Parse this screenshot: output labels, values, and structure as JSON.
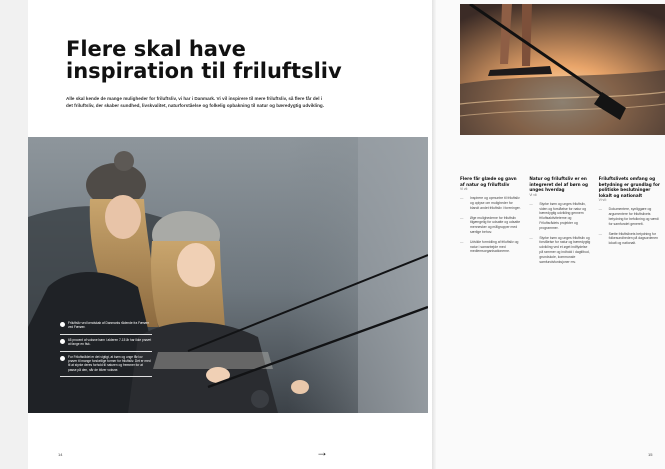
{
  "title_line1": "Flere skal have",
  "title_line2": "inspiration til friluftsliv",
  "intro": "Alle skal kende de mange muligheder for friluftsliv, vi har i Danmark. Vi vil inspirere til mere friluftsliv, så flere får del i det friluftsliv, der skaber sundhed, livskvalitet, naturforståelse og folkelig opbakning til natur og bæredygtig udvikling.",
  "facts": [
    "Friluftsliv ved kendskab af Danmarks rådende fra Færøer ved Færøer.",
    "65 procent af voksne børn i alderen 7-15 år har ikke prøvet at fange en fisk.",
    "For Friluftsrådet er det vigtigt, at børn og unge får lov prøver til mange forskellige former for friluftsliv. Det er med til at styrke deres forhold til naturen og fremmer for at passe på den, når de bliver voksne."
  ],
  "columns": [
    {
      "title": "Flere får glæde og gavn af natur og friluftsliv",
      "sub": "Vi vil:",
      "items": [
        "Inspirere og opmuntre til friluftsliv og oplyse om muligheder for blandt andet friluftsliv i foreninger.",
        "Øge mulighederne for friluftsliv tilgængelig for udsatte og udsatte mennesker og målgrupper med særlige behov.",
        "Udvikle formidling af friluftsliv og natur i samarbejde med medlemsorganisationerne."
      ]
    },
    {
      "title": "Natur og friluftsliv er en integreret del af børn og unges hverdag",
      "sub": "Vi vil:",
      "items": [
        "Styrke børn og unges friluftsliv, viden og forståelse for natur og bæredygtig udvikling gennem friluftsaktiviteterne og Friluftsrådets projekter og programmer.",
        "Styrke børn og unges friluftsliv og forståelse for natur og bæredygtig udvikling ved et øget indflydelse på rammer og indhold i dagtilbud, grundskole, kommunale samfundsfunksjoner mv."
      ]
    },
    {
      "title": "Friluftslivets omfang og betydning er grundlag for politiske beslutninger lokalt og nationalt",
      "sub": "Vi vil:",
      "items": [
        "Dokumentere, synliggøre og argumentere for friluftslivets betydning for befolkning og værdi for samfundet generelt.",
        "Sætte friluftslivets betydning for folkesundheden på dagsordenen lokalt og nationalt."
      ]
    }
  ],
  "page_left": "14",
  "page_right": "15",
  "arrow": "→"
}
